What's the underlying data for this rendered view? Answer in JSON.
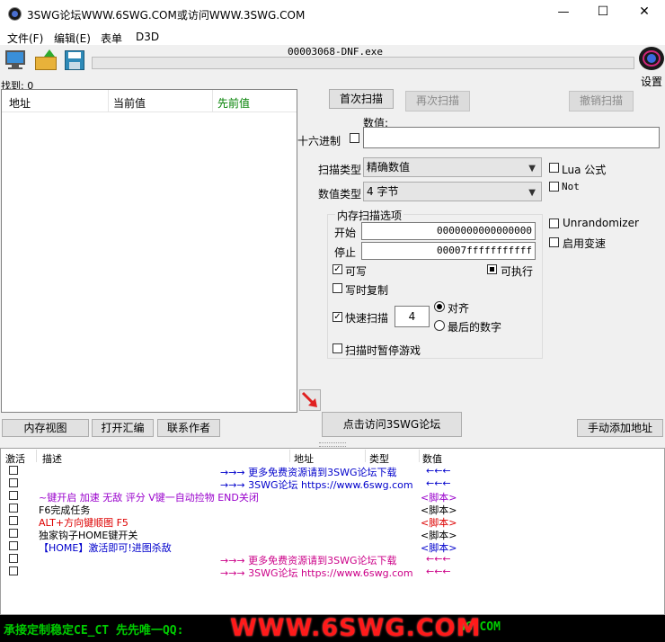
{
  "window": {
    "title": "3SWG论坛WWW.6SWG.COM或访问WWW.3SWG.COM",
    "minimize": "—",
    "maximize": "☐",
    "close": "✕"
  },
  "menu": [
    "文件(F)",
    "编辑(E)",
    "表单",
    "D3D"
  ],
  "process": {
    "name": "00003068-DNF.exe"
  },
  "settings_label": "设置",
  "found_label": "找到: 0",
  "results_table": {
    "columns": [
      "地址",
      "当前值",
      "先前值"
    ]
  },
  "scan": {
    "first_scan": "首次扫描",
    "next_scan": "再次扫描",
    "undo_scan": "撤销扫描",
    "value_label": "数值:",
    "hex_label": "十六进制",
    "value_input": "",
    "scan_type_label": "扫描类型",
    "scan_type_value": "精确数值",
    "value_type_label": "数值类型",
    "value_type_value": "4 字节",
    "lua_label": "Lua 公式",
    "not_label": "Not",
    "unrandomizer_label": "Unrandomizer",
    "speedhack_label": "启用变速"
  },
  "memory_options": {
    "title": "内存扫描选项",
    "start_label": "开始",
    "start_value": "0000000000000000",
    "stop_label": "停止",
    "stop_value": "00007fffffffffff",
    "writable_label": "可写",
    "executable_label": "可执行",
    "copy_on_write_label": "写时复制",
    "fast_scan_label": "快速扫描",
    "fast_scan_value": "4",
    "align_label": "对齐",
    "last_digits_label": "最后的数字",
    "pause_label": "扫描时暂停游戏"
  },
  "bottom_buttons": {
    "memory_view": "内存视图",
    "open_compile": "打开汇编",
    "contact_author": "联系作者",
    "visit_forum": "点击访问3SWG论坛",
    "add_address": "手动添加地址"
  },
  "cheat_table": {
    "columns": [
      "激活",
      "描述",
      "地址",
      "类型",
      "数值"
    ],
    "rows": [
      {
        "desc": "→→→  更多免费资源请到3SWG论坛下载",
        "value": "←←←",
        "color": "#0000cc"
      },
      {
        "desc": "→→→  3SWG论坛 https://www.6swg.com",
        "value": "←←←",
        "color": "#0000cc"
      },
      {
        "desc": "~键开启 加速 无敌  评分 V键一自动捡物 END关闭",
        "value": "<脚本>",
        "color": "#9900cc"
      },
      {
        "desc": "F6完成任务",
        "value": "<脚本>",
        "color": "#000000"
      },
      {
        "desc": "ALT+方向键顺图 F5",
        "value": "<脚本>",
        "color": "#dd0000"
      },
      {
        "desc": "独家钩子HOME键开关",
        "value": "<脚本>",
        "color": "#000000"
      },
      {
        "desc": "【HOME】激活即可!进图杀敌",
        "value": "<脚本>",
        "color": "#0000cc"
      },
      {
        "desc": "→→→  更多免费资源请到3SWG论坛下载",
        "value": "←←←",
        "color": "#cc0088"
      },
      {
        "desc": "→→→  3SWG论坛 https://www.6swg.com",
        "value": "←←←",
        "color": "#cc0088"
      }
    ]
  },
  "footer": {
    "marquee": "承接定制稳定CE_CT  先先唯一QQ:",
    "tail": "WG.COM",
    "brand": "WWW.6SWG.COM"
  },
  "colors": {
    "prev_value_header": "#008000",
    "footer_bg": "#000000",
    "footer_text": "#00cc00",
    "brand_red": "#ff0000"
  }
}
